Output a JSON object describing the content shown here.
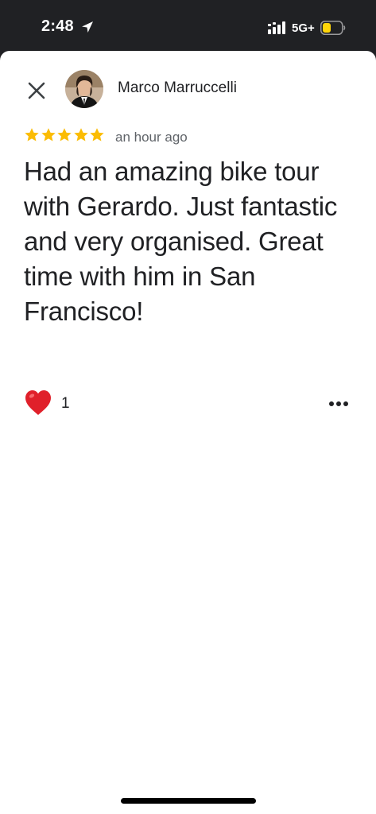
{
  "status_bar": {
    "time": "2:48",
    "network": "5G+",
    "icons": [
      "location-arrow-icon",
      "signal-icon",
      "battery-icon"
    ],
    "battery_color": "#ffd60a"
  },
  "review": {
    "close_icon": "close-icon",
    "author": "Marco Marruccelli",
    "rating": 5,
    "max_rating": 5,
    "star_color": "#fbbc04",
    "time_ago": "an hour ago",
    "text": "Had an amazing bike tour with Gerardo. Just fantastic and very organised. Great time with him in San Francisco!",
    "reaction_icon": "heart-icon",
    "reaction_color": "#e0202a",
    "like_count": "1",
    "more_icon": "more-options-icon"
  }
}
